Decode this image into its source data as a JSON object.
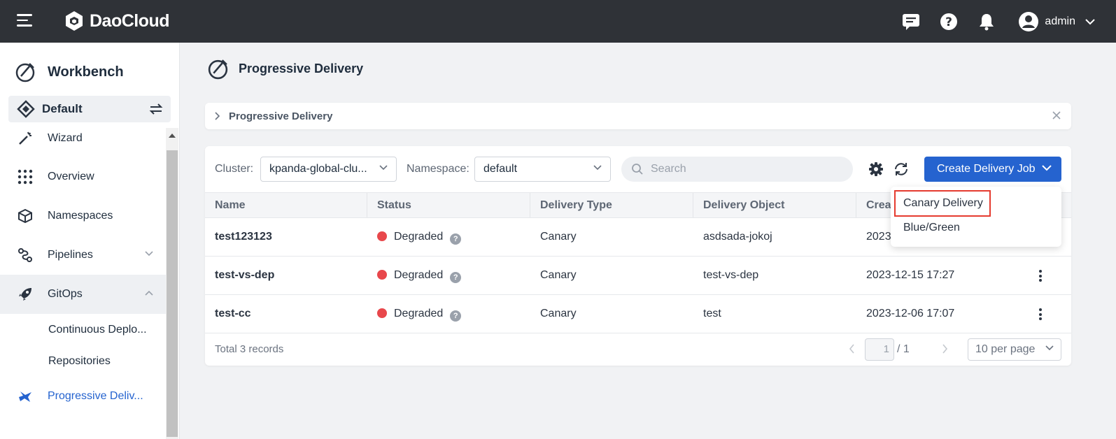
{
  "app": {
    "brand": "DaoCloud",
    "user": "admin"
  },
  "sidebar": {
    "title": "Workbench",
    "workspace": "Default",
    "items": [
      {
        "label": "Wizard"
      },
      {
        "label": "Overview"
      },
      {
        "label": "Namespaces"
      },
      {
        "label": "Pipelines"
      },
      {
        "label": "GitOps"
      },
      {
        "label": "Continuous Deplo..."
      },
      {
        "label": "Repositories"
      },
      {
        "label": "Progressive Deliv..."
      }
    ]
  },
  "page": {
    "title": "Progressive Delivery",
    "breadcrumb": "Progressive Delivery"
  },
  "toolbar": {
    "cluster_label": "Cluster:",
    "cluster_value": "kpanda-global-clu...",
    "namespace_label": "Namespace:",
    "namespace_value": "default",
    "search_placeholder": "Search",
    "create_button": "Create Delivery Job"
  },
  "table": {
    "columns": [
      "Name",
      "Status",
      "Delivery Type",
      "Delivery Object",
      "Creat"
    ],
    "rows": [
      {
        "name": "test123123",
        "status": "Degraded",
        "type": "Canary",
        "object": "asdsada-jokoj",
        "created": "2023"
      },
      {
        "name": "test-vs-dep",
        "status": "Degraded",
        "type": "Canary",
        "object": "test-vs-dep",
        "created": "2023-12-15 17:27"
      },
      {
        "name": "test-cc",
        "status": "Degraded",
        "type": "Canary",
        "object": "test",
        "created": "2023-12-06 17:07"
      }
    ],
    "total": "Total 3 records",
    "page_current": "1",
    "page_of": "/ 1",
    "per_page": "10 per page"
  },
  "menu": {
    "items": [
      "Canary Delivery",
      "Blue/Green"
    ]
  },
  "colors": {
    "accent": "#2563cf",
    "status_degraded": "#e8474b",
    "highlight": "#e53b2f"
  }
}
